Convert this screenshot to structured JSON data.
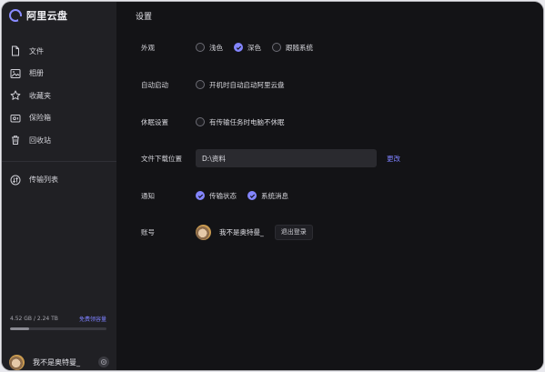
{
  "app": {
    "brand": "阿里云盘"
  },
  "sidebar": {
    "items": [
      {
        "label": "文件",
        "icon": "file-icon"
      },
      {
        "label": "相册",
        "icon": "photo-icon"
      },
      {
        "label": "收藏夹",
        "icon": "star-icon"
      },
      {
        "label": "保险箱",
        "icon": "safe-icon"
      },
      {
        "label": "回收站",
        "icon": "trash-icon"
      }
    ],
    "transfer": {
      "label": "传输列表",
      "icon": "transfer-icon"
    },
    "storage": {
      "used_text": "4.52 GB / 2.24 TB",
      "link": "免费领容量",
      "fill_percent": 0.2
    },
    "user": {
      "name": "我不是奥特曼_"
    }
  },
  "settings": {
    "title": "设置",
    "appearance": {
      "label": "外观",
      "options": [
        "浅色",
        "深色",
        "跟随系统"
      ],
      "selected": "深色"
    },
    "autostart": {
      "label": "自动启动",
      "option": "开机时自动启动阿里云盘",
      "checked": false
    },
    "sleep": {
      "label": "休眠设置",
      "option": "有传输任务时电脑不休眠",
      "checked": false
    },
    "download": {
      "label": "文件下载位置",
      "path": "D:\\资料",
      "change": "更改"
    },
    "notify": {
      "label": "通知",
      "options": [
        "传输状态",
        "系统消息"
      ],
      "checked": [
        true,
        true
      ]
    },
    "account": {
      "label": "账号",
      "name": "我不是奥特曼_",
      "logout": "退出登录"
    }
  },
  "colors": {
    "accent": "#8385ff",
    "sidebar_bg": "#202024",
    "main_bg": "#131316"
  }
}
